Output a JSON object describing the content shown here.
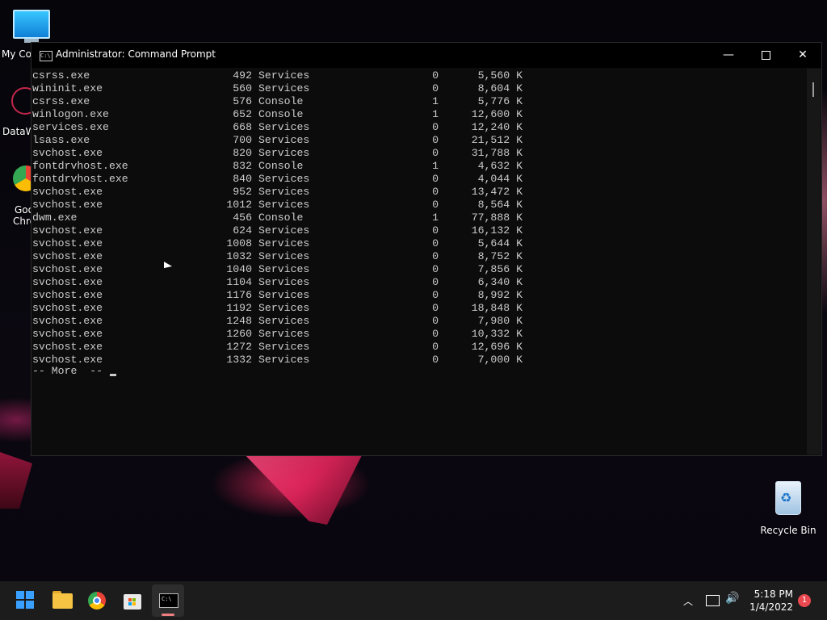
{
  "desktop": {
    "icons": {
      "my_computer": "My Co",
      "datawrangler": "DataW",
      "chrome_line1": "Goo",
      "chrome_line2": "Chro",
      "recycle_bin": "Recycle Bin"
    }
  },
  "window": {
    "title": "Administrator: Command Prompt",
    "app_icon_text": "C:\\",
    "minimize": "—",
    "close": "✕"
  },
  "console": {
    "rows": [
      {
        "name": "csrss.exe",
        "pid": "492",
        "session": "Services",
        "num": "0",
        "mem": "5,560 K"
      },
      {
        "name": "wininit.exe",
        "pid": "560",
        "session": "Services",
        "num": "0",
        "mem": "8,604 K"
      },
      {
        "name": "csrss.exe",
        "pid": "576",
        "session": "Console",
        "num": "1",
        "mem": "5,776 K"
      },
      {
        "name": "winlogon.exe",
        "pid": "652",
        "session": "Console",
        "num": "1",
        "mem": "12,600 K"
      },
      {
        "name": "services.exe",
        "pid": "668",
        "session": "Services",
        "num": "0",
        "mem": "12,240 K"
      },
      {
        "name": "lsass.exe",
        "pid": "700",
        "session": "Services",
        "num": "0",
        "mem": "21,512 K"
      },
      {
        "name": "svchost.exe",
        "pid": "820",
        "session": "Services",
        "num": "0",
        "mem": "31,788 K"
      },
      {
        "name": "fontdrvhost.exe",
        "pid": "832",
        "session": "Console",
        "num": "1",
        "mem": "4,632 K"
      },
      {
        "name": "fontdrvhost.exe",
        "pid": "840",
        "session": "Services",
        "num": "0",
        "mem": "4,044 K"
      },
      {
        "name": "svchost.exe",
        "pid": "952",
        "session": "Services",
        "num": "0",
        "mem": "13,472 K"
      },
      {
        "name": "svchost.exe",
        "pid": "1012",
        "session": "Services",
        "num": "0",
        "mem": "8,564 K"
      },
      {
        "name": "dwm.exe",
        "pid": "456",
        "session": "Console",
        "num": "1",
        "mem": "77,888 K"
      },
      {
        "name": "svchost.exe",
        "pid": "624",
        "session": "Services",
        "num": "0",
        "mem": "16,132 K"
      },
      {
        "name": "svchost.exe",
        "pid": "1008",
        "session": "Services",
        "num": "0",
        "mem": "5,644 K"
      },
      {
        "name": "svchost.exe",
        "pid": "1032",
        "session": "Services",
        "num": "0",
        "mem": "8,752 K"
      },
      {
        "name": "svchost.exe",
        "pid": "1040",
        "session": "Services",
        "num": "0",
        "mem": "7,856 K"
      },
      {
        "name": "svchost.exe",
        "pid": "1104",
        "session": "Services",
        "num": "0",
        "mem": "6,340 K"
      },
      {
        "name": "svchost.exe",
        "pid": "1176",
        "session": "Services",
        "num": "0",
        "mem": "8,992 K"
      },
      {
        "name": "svchost.exe",
        "pid": "1192",
        "session": "Services",
        "num": "0",
        "mem": "18,848 K"
      },
      {
        "name": "svchost.exe",
        "pid": "1248",
        "session": "Services",
        "num": "0",
        "mem": "7,980 K"
      },
      {
        "name": "svchost.exe",
        "pid": "1260",
        "session": "Services",
        "num": "0",
        "mem": "10,332 K"
      },
      {
        "name": "svchost.exe",
        "pid": "1272",
        "session": "Services",
        "num": "0",
        "mem": "12,696 K"
      },
      {
        "name": "svchost.exe",
        "pid": "1332",
        "session": "Services",
        "num": "0",
        "mem": "7,000 K"
      }
    ],
    "more_prompt": "-- More  --"
  },
  "taskbar": {
    "clock_time": "5:18 PM",
    "clock_date": "1/4/2022",
    "notification_count": "1",
    "tray_chevron": "︿",
    "volume_glyph": "🔊"
  },
  "colors": {
    "console_bg": "#0c0c0c",
    "console_text": "#cccccc",
    "taskbar_bg": "#1c1c1c",
    "notification_badge": "#e8484e"
  }
}
